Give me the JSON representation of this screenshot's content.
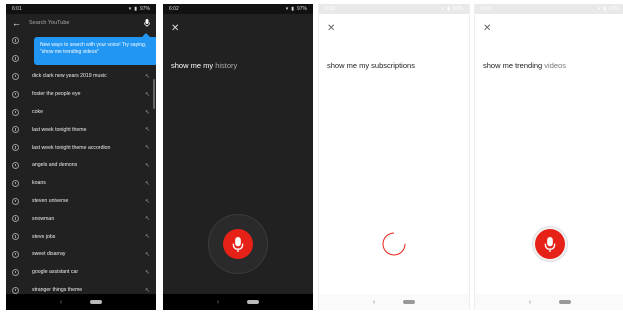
{
  "accent": "#e62117",
  "tooltip_color": "#2196f3",
  "screen1": {
    "status_time": "6:01",
    "status_battery": "97%",
    "search_placeholder": "Search YouTube",
    "tooltip_text": "New ways to search with your voice! Try saying, \"show me trending videos\"",
    "history": [
      "",
      "",
      "dick clark new years 2019 music",
      "foster the people eye",
      "coke",
      "last week tonight theme",
      "last week tonight theme accordion",
      "angels and demons",
      "koans",
      "steven universe",
      "snowman",
      "steve jobs",
      "sweet disarray",
      "google assistant car",
      "stranger things theme"
    ],
    "icons": [
      "back-arrow-icon",
      "mic-icon",
      "history-icon",
      "fill-query-arrow-icon"
    ]
  },
  "screen2": {
    "status_time": "6:02",
    "status_battery": "97%",
    "query_main": "show me my",
    "query_partial": "history"
  },
  "screen3": {
    "status_time": "6:02",
    "status_battery": "97%",
    "query_main": "show me my subscriptions",
    "query_partial": ""
  },
  "screen4": {
    "status_time": "6:03",
    "status_battery": "97%",
    "query_main": "show me trending",
    "query_partial": "videos"
  }
}
